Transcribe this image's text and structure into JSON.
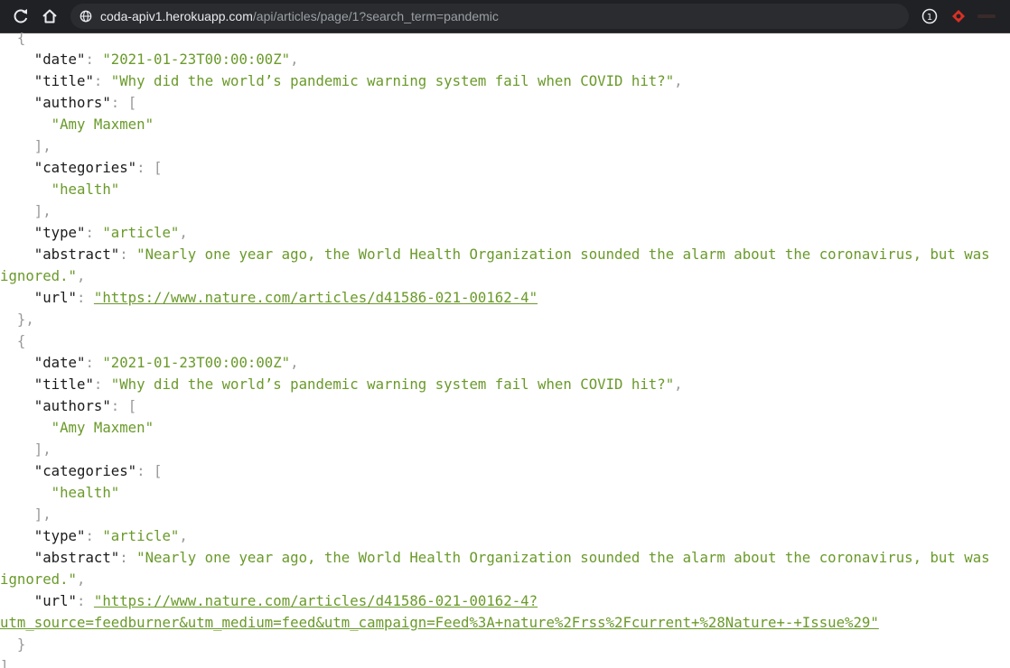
{
  "browser": {
    "url_host": "coda-apiv1.herokuapp.com",
    "url_path": "/api/articles/page/1?search_term=pandemic",
    "icons": [
      "reload-icon",
      "home-icon",
      "site-info-icon",
      "extension-icon",
      "extension-icon",
      "extension-icon"
    ]
  },
  "json": {
    "records": [
      {
        "date": "\"2021-01-23T00:00:00Z\"",
        "title": "\"Why did the world’s pandemic warning system fail when COVID hit?\"",
        "author": "\"Amy Maxmen\"",
        "category": "\"health\"",
        "type": "\"article\"",
        "abstract_line1": "\"Nearly one year ago, the World Health Organization sounded the alarm about the coronavirus, but was",
        "abstract_line2": "ignored.\"",
        "url_line1": "\"https://www.nature.com/articles/d41586-021-00162-4\""
      },
      {
        "date": "\"2021-01-23T00:00:00Z\"",
        "title": "\"Why did the world’s pandemic warning system fail when COVID hit?\"",
        "author": "\"Amy Maxmen\"",
        "category": "\"health\"",
        "type": "\"article\"",
        "abstract_line1": "\"Nearly one year ago, the World Health Organization sounded the alarm about the coronavirus, but was",
        "abstract_line2": "ignored.\"",
        "url_line1": "\"https://www.nature.com/articles/d41586-021-00162-4?",
        "url_line2": "utm_source=feedburner&utm_medium=feed&utm_campaign=Feed%3A+nature%2Frss%2Fcurrent+%28Nature+-+Issue%29\""
      }
    ],
    "keys": {
      "date": "\"date\"",
      "title": "\"title\"",
      "authors": "\"authors\"",
      "categories": "\"categories\"",
      "type": "\"type\"",
      "abstract": "\"abstract\"",
      "url": "\"url\""
    },
    "punctuation": {
      "open_brace": "{",
      "close_brace": "}",
      "close_brace_comma": "},",
      "open_bracket": "[",
      "close_bracket_comma": "],",
      "close_bracket": "]",
      "colon": ": ",
      "comma": ","
    }
  }
}
